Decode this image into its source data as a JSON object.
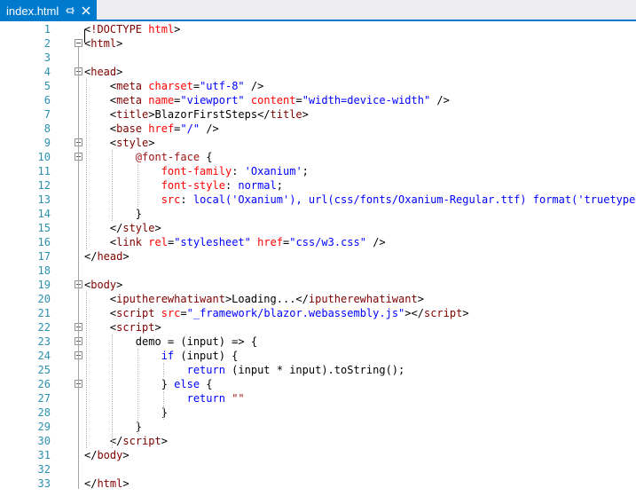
{
  "tab": {
    "title": "index.html",
    "pin_icon": "pin-icon",
    "close_icon": "close-icon",
    "accent": "#007acc"
  },
  "lines": [
    {
      "n": "1",
      "fold": false,
      "segs": [
        [
          "t-plain",
          "<"
        ],
        [
          "t-tag",
          "!DOCTYPE"
        ],
        [
          "t-plain",
          " "
        ],
        [
          "t-attr",
          "html"
        ],
        [
          "t-plain",
          ">"
        ]
      ]
    },
    {
      "n": "2",
      "fold": true,
      "segs": [
        [
          "t-plain",
          "<"
        ],
        [
          "t-tag",
          "html"
        ],
        [
          "t-plain",
          ">"
        ]
      ]
    },
    {
      "n": "3",
      "fold": false,
      "segs": []
    },
    {
      "n": "4",
      "fold": true,
      "segs": [
        [
          "t-plain",
          "<"
        ],
        [
          "t-tag",
          "head"
        ],
        [
          "t-plain",
          ">"
        ]
      ]
    },
    {
      "n": "5",
      "fold": false,
      "segs": [
        [
          "t-plain",
          "    <"
        ],
        [
          "t-tag",
          "meta"
        ],
        [
          "t-plain",
          " "
        ],
        [
          "t-attr",
          "charset"
        ],
        [
          "t-plain",
          "="
        ],
        [
          "t-val",
          "\"utf-8\""
        ],
        [
          "t-plain",
          " />"
        ]
      ]
    },
    {
      "n": "6",
      "fold": false,
      "segs": [
        [
          "t-plain",
          "    <"
        ],
        [
          "t-tag",
          "meta"
        ],
        [
          "t-plain",
          " "
        ],
        [
          "t-attr",
          "name"
        ],
        [
          "t-plain",
          "="
        ],
        [
          "t-val",
          "\"viewport\""
        ],
        [
          "t-plain",
          " "
        ],
        [
          "t-attr",
          "content"
        ],
        [
          "t-plain",
          "="
        ],
        [
          "t-val",
          "\"width=device-width\""
        ],
        [
          "t-plain",
          " />"
        ]
      ]
    },
    {
      "n": "7",
      "fold": false,
      "segs": [
        [
          "t-plain",
          "    <"
        ],
        [
          "t-tag",
          "title"
        ],
        [
          "t-plain",
          ">BlazorFirstSteps</"
        ],
        [
          "t-tag",
          "title"
        ],
        [
          "t-plain",
          ">"
        ]
      ]
    },
    {
      "n": "8",
      "fold": false,
      "segs": [
        [
          "t-plain",
          "    <"
        ],
        [
          "t-tag",
          "base"
        ],
        [
          "t-plain",
          " "
        ],
        [
          "t-attr",
          "href"
        ],
        [
          "t-plain",
          "="
        ],
        [
          "t-val",
          "\"/\""
        ],
        [
          "t-plain",
          " />"
        ]
      ]
    },
    {
      "n": "9",
      "fold": true,
      "segs": [
        [
          "t-plain",
          "    <"
        ],
        [
          "t-tag",
          "style"
        ],
        [
          "t-plain",
          ">"
        ]
      ]
    },
    {
      "n": "10",
      "fold": true,
      "segs": [
        [
          "t-plain",
          "        "
        ],
        [
          "t-css",
          "@font-face"
        ],
        [
          "t-plain",
          " {"
        ]
      ]
    },
    {
      "n": "11",
      "fold": false,
      "segs": [
        [
          "t-plain",
          "            "
        ],
        [
          "t-attr",
          "font-family"
        ],
        [
          "t-plain",
          ": "
        ],
        [
          "t-val",
          "'Oxanium'"
        ],
        [
          "t-plain",
          ";"
        ]
      ]
    },
    {
      "n": "12",
      "fold": false,
      "segs": [
        [
          "t-plain",
          "            "
        ],
        [
          "t-attr",
          "font-style"
        ],
        [
          "t-plain",
          ": "
        ],
        [
          "t-val",
          "normal"
        ],
        [
          "t-plain",
          ";"
        ]
      ]
    },
    {
      "n": "13",
      "fold": false,
      "segs": [
        [
          "t-plain",
          "            "
        ],
        [
          "t-attr",
          "src"
        ],
        [
          "t-plain",
          ": "
        ],
        [
          "t-val",
          "local('Oxanium'), url(css/fonts/Oxanium-Regular.ttf) format('truetype')"
        ],
        [
          "t-plain",
          ";"
        ]
      ]
    },
    {
      "n": "14",
      "fold": false,
      "segs": [
        [
          "t-plain",
          "        }"
        ]
      ]
    },
    {
      "n": "15",
      "fold": false,
      "segs": [
        [
          "t-plain",
          "    </"
        ],
        [
          "t-tag",
          "style"
        ],
        [
          "t-plain",
          ">"
        ]
      ]
    },
    {
      "n": "16",
      "fold": false,
      "segs": [
        [
          "t-plain",
          "    <"
        ],
        [
          "t-tag",
          "link"
        ],
        [
          "t-plain",
          " "
        ],
        [
          "t-attr",
          "rel"
        ],
        [
          "t-plain",
          "="
        ],
        [
          "t-val",
          "\"stylesheet\""
        ],
        [
          "t-plain",
          " "
        ],
        [
          "t-attr",
          "href"
        ],
        [
          "t-plain",
          "="
        ],
        [
          "t-val",
          "\"css/w3.css\""
        ],
        [
          "t-plain",
          " />"
        ]
      ]
    },
    {
      "n": "17",
      "fold": false,
      "segs": [
        [
          "t-plain",
          "</"
        ],
        [
          "t-tag",
          "head"
        ],
        [
          "t-plain",
          ">"
        ]
      ]
    },
    {
      "n": "18",
      "fold": false,
      "segs": []
    },
    {
      "n": "19",
      "fold": true,
      "segs": [
        [
          "t-plain",
          "<"
        ],
        [
          "t-tag",
          "body"
        ],
        [
          "t-plain",
          ">"
        ]
      ]
    },
    {
      "n": "20",
      "fold": false,
      "segs": [
        [
          "t-plain",
          "    <"
        ],
        [
          "t-tag",
          "iputherewhatiwant"
        ],
        [
          "t-plain",
          ">Loading...</"
        ],
        [
          "t-tag",
          "iputherewhatiwant"
        ],
        [
          "t-plain",
          ">"
        ]
      ]
    },
    {
      "n": "21",
      "fold": false,
      "segs": [
        [
          "t-plain",
          "    <"
        ],
        [
          "t-tag",
          "script"
        ],
        [
          "t-plain",
          " "
        ],
        [
          "t-attr",
          "src"
        ],
        [
          "t-plain",
          "="
        ],
        [
          "t-val",
          "\"_framework/blazor.webassembly.js\""
        ],
        [
          "t-plain",
          "></"
        ],
        [
          "t-tag",
          "script"
        ],
        [
          "t-plain",
          ">"
        ]
      ]
    },
    {
      "n": "22",
      "fold": true,
      "segs": [
        [
          "t-plain",
          "    <"
        ],
        [
          "t-tag",
          "script"
        ],
        [
          "t-plain",
          ">"
        ]
      ]
    },
    {
      "n": "23",
      "fold": true,
      "segs": [
        [
          "t-plain",
          "        demo = (input) => {"
        ]
      ]
    },
    {
      "n": "24",
      "fold": true,
      "segs": [
        [
          "t-plain",
          "            "
        ],
        [
          "t-kw",
          "if"
        ],
        [
          "t-plain",
          " (input) {"
        ]
      ]
    },
    {
      "n": "25",
      "fold": false,
      "segs": [
        [
          "t-plain",
          "                "
        ],
        [
          "t-kw",
          "return"
        ],
        [
          "t-plain",
          " (input * input).toString();"
        ]
      ]
    },
    {
      "n": "26",
      "fold": true,
      "segs": [
        [
          "t-plain",
          "            } "
        ],
        [
          "t-kw",
          "else"
        ],
        [
          "t-plain",
          " {"
        ]
      ]
    },
    {
      "n": "27",
      "fold": false,
      "segs": [
        [
          "t-plain",
          "                "
        ],
        [
          "t-kw",
          "return"
        ],
        [
          "t-plain",
          " "
        ],
        [
          "t-css",
          "\"\""
        ]
      ]
    },
    {
      "n": "28",
      "fold": false,
      "segs": [
        [
          "t-plain",
          "            }"
        ]
      ]
    },
    {
      "n": "29",
      "fold": false,
      "segs": [
        [
          "t-plain",
          "        }"
        ]
      ]
    },
    {
      "n": "30",
      "fold": false,
      "segs": [
        [
          "t-plain",
          "    </"
        ],
        [
          "t-tag",
          "script"
        ],
        [
          "t-plain",
          ">"
        ]
      ]
    },
    {
      "n": "31",
      "fold": false,
      "segs": [
        [
          "t-plain",
          "</"
        ],
        [
          "t-tag",
          "body"
        ],
        [
          "t-plain",
          ">"
        ]
      ]
    },
    {
      "n": "32",
      "fold": false,
      "segs": []
    },
    {
      "n": "33",
      "fold": false,
      "segs": [
        [
          "t-plain",
          "</"
        ],
        [
          "t-tag",
          "html"
        ],
        [
          "t-plain",
          ">"
        ]
      ]
    }
  ]
}
